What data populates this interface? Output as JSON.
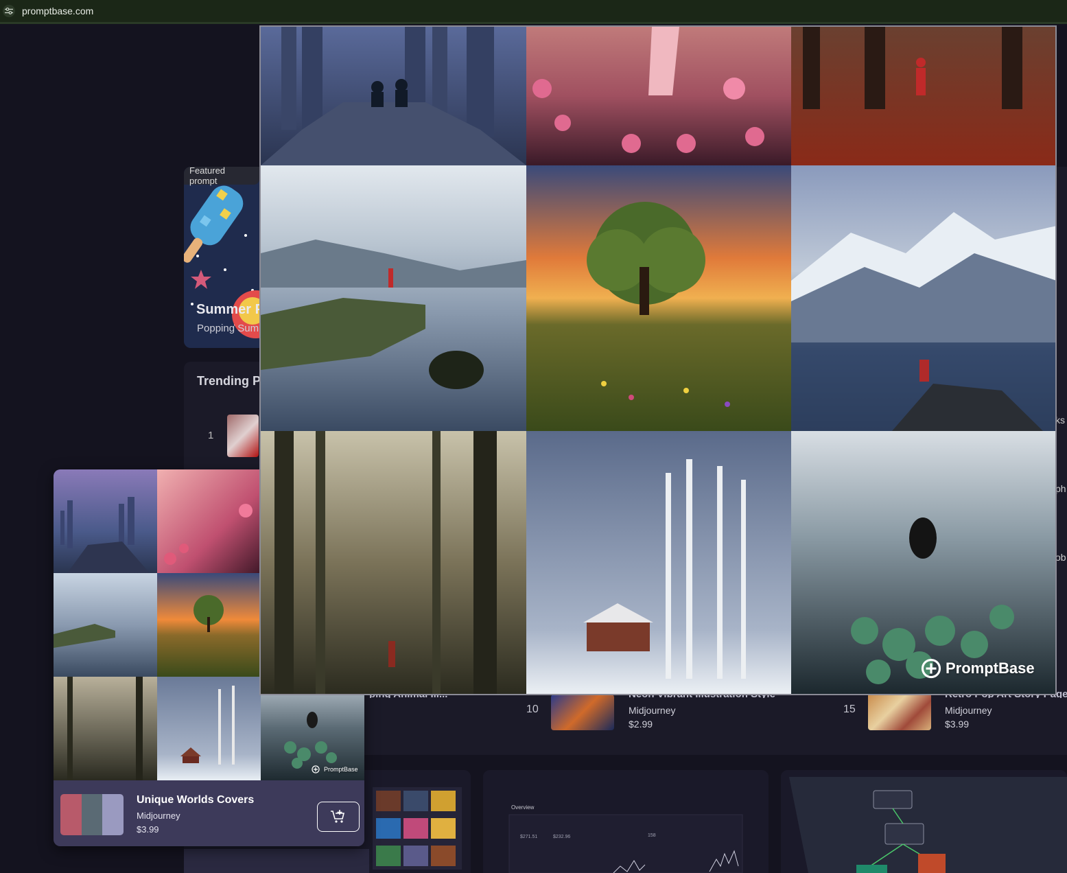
{
  "browser": {
    "url": "promptbase.com",
    "site_icon": "tune-icon"
  },
  "featured": {
    "badge": "Featured prompt",
    "title": "Summer P",
    "subtitle": "Popping Sumr"
  },
  "trending": {
    "title": "Trending Pr",
    "first_rank": "1"
  },
  "right_edge_fragments": [
    "ks",
    "ph",
    "ob"
  ],
  "list_row": {
    "items": [
      {
        "title_cut": "ping Animal Ill...",
        "rank": null,
        "model": null,
        "price": null
      },
      {
        "rank": "10",
        "title_cut": "Neon Vibrant Illustration Style",
        "model": "Midjourney",
        "price": "$2.99"
      },
      {
        "rank": "15",
        "title_cut": "Retro Pop Art Story Page",
        "model": "Midjourney",
        "price": "$3.99"
      }
    ]
  },
  "dashboard_preview": {
    "overview_label": "Overview",
    "stat1": "$271.51",
    "stat2": "$232.96",
    "stat3": "158"
  },
  "preview_card": {
    "title": "Unique Worlds Covers",
    "model": "Midjourney",
    "price": "$3.99",
    "cart_icon": "add-to-cart-icon",
    "watermark": "PromptBase"
  },
  "big_preview": {
    "watermark": "PromptBase",
    "tiles": [
      "night-city-cliff",
      "pink-blossom-meadow",
      "autumn-forest-red-coat",
      "misty-lake-figure",
      "sunset-tree-meadow",
      "snowy-mountain-peak",
      "foggy-pine-forest",
      "snowy-birch-cabin",
      "misty-lake-boat-lilypads"
    ]
  }
}
